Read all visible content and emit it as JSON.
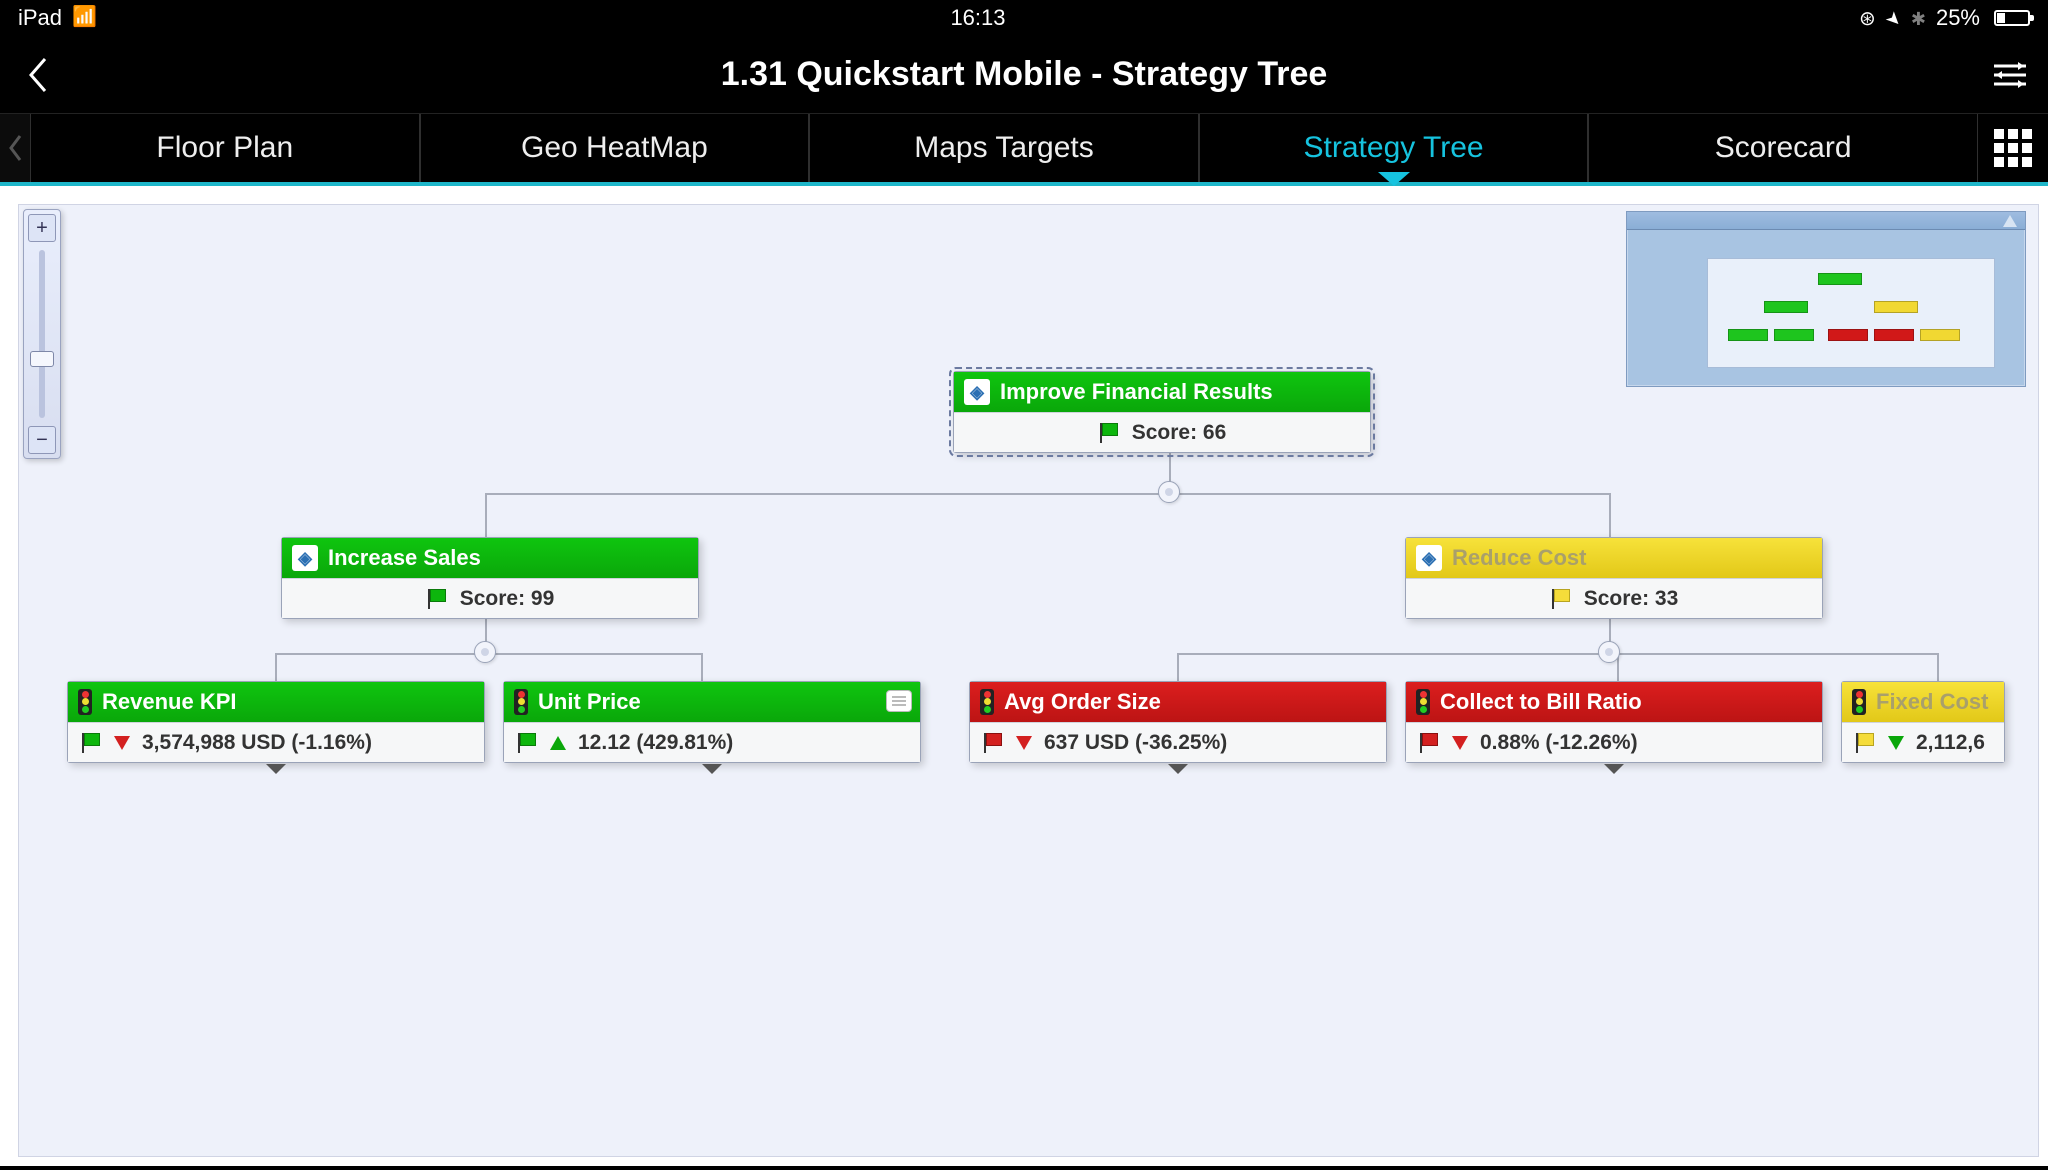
{
  "status": {
    "device": "iPad",
    "time": "16:13",
    "battery_pct": "25%"
  },
  "nav": {
    "title": "1.31 Quickstart Mobile - Strategy Tree"
  },
  "tabs": {
    "items": [
      {
        "label": "Floor Plan"
      },
      {
        "label": "Geo HeatMap"
      },
      {
        "label": "Maps Targets"
      },
      {
        "label": "Strategy Tree"
      },
      {
        "label": "Scorecard"
      }
    ],
    "active_index": 3
  },
  "tree": {
    "root": {
      "title": "Improve Financial Results",
      "score_label": "Score: 66",
      "status_color": "green",
      "flag": "green"
    },
    "level2": [
      {
        "id": "increase-sales",
        "title": "Increase Sales",
        "score_label": "Score: 99",
        "status_color": "green",
        "flag": "green"
      },
      {
        "id": "reduce-cost",
        "title": "Reduce Cost",
        "score_label": "Score: 33",
        "status_color": "yellow",
        "flag": "yellow"
      }
    ],
    "kpis": [
      {
        "id": "revenue-kpi",
        "title": "Revenue KPI",
        "status_color": "green",
        "flag": "green",
        "trend": "down-red",
        "value": "3,574,988 USD (-1.16%)"
      },
      {
        "id": "unit-price",
        "title": "Unit Price",
        "status_color": "green",
        "flag": "green",
        "trend": "up-green",
        "value": "12.12 (429.81%)",
        "has_comment": true
      },
      {
        "id": "avg-order-size",
        "title": "Avg Order Size",
        "status_color": "red",
        "flag": "red",
        "trend": "down-red",
        "value": "637 USD (-36.25%)"
      },
      {
        "id": "collect-to-bill",
        "title": "Collect to Bill Ratio",
        "status_color": "red",
        "flag": "red",
        "trend": "down-red",
        "value": "0.88% (-12.26%)"
      },
      {
        "id": "fixed-cost",
        "title": "Fixed Cost",
        "status_color": "yellow",
        "flag": "yellow",
        "trend": "down-green",
        "value": "2,112,6"
      }
    ]
  },
  "colors": {
    "green": "#0db60d",
    "yellow": "#f1d832",
    "red": "#d11818",
    "accent": "#16c3df"
  }
}
